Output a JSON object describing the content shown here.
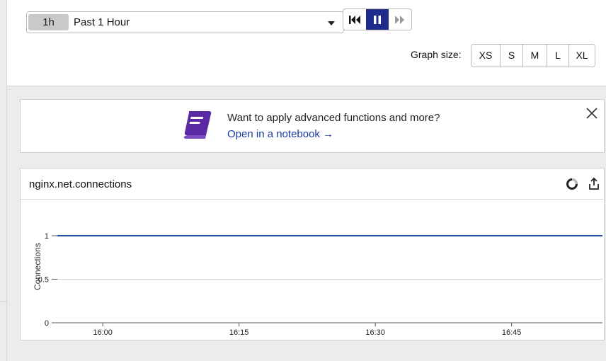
{
  "time_selector": {
    "badge": "1h",
    "label": "Past 1 Hour"
  },
  "playback": {
    "rewind_icon": "rewind-icon",
    "pause_icon": "pause-icon",
    "forward_icon": "fast-forward-icon",
    "active": "pause"
  },
  "graph_size": {
    "label": "Graph size:",
    "options": [
      "XS",
      "S",
      "M",
      "L",
      "XL"
    ]
  },
  "banner": {
    "icon": "notebook-icon",
    "title": "Want to apply advanced functions and more?",
    "link": "Open in a notebook →",
    "close_icon": "close-icon"
  },
  "graph": {
    "title": "nginx.net.connections",
    "loading_icon": "loading-spinner-icon",
    "share_icon": "share-icon"
  },
  "chart_data": {
    "type": "line",
    "ylabel": "Connections",
    "xlabel": "",
    "y_ticks": [
      "0",
      "0.5",
      "1"
    ],
    "ylim": [
      0,
      1.2
    ],
    "x_ticks": [
      "16:00",
      "16:15",
      "16:30",
      "16:45"
    ],
    "x": [
      "15:55",
      "16:00",
      "16:15",
      "16:30",
      "16:45",
      "16:55"
    ],
    "series": [
      {
        "values": [
          1,
          1,
          1,
          1,
          1,
          1
        ],
        "color": "#1f4e9c"
      }
    ],
    "grid": true
  },
  "colors": {
    "accent": "#1f2a8a",
    "notebook_icon": "#5b2aa3",
    "link": "#1b3aa0"
  }
}
